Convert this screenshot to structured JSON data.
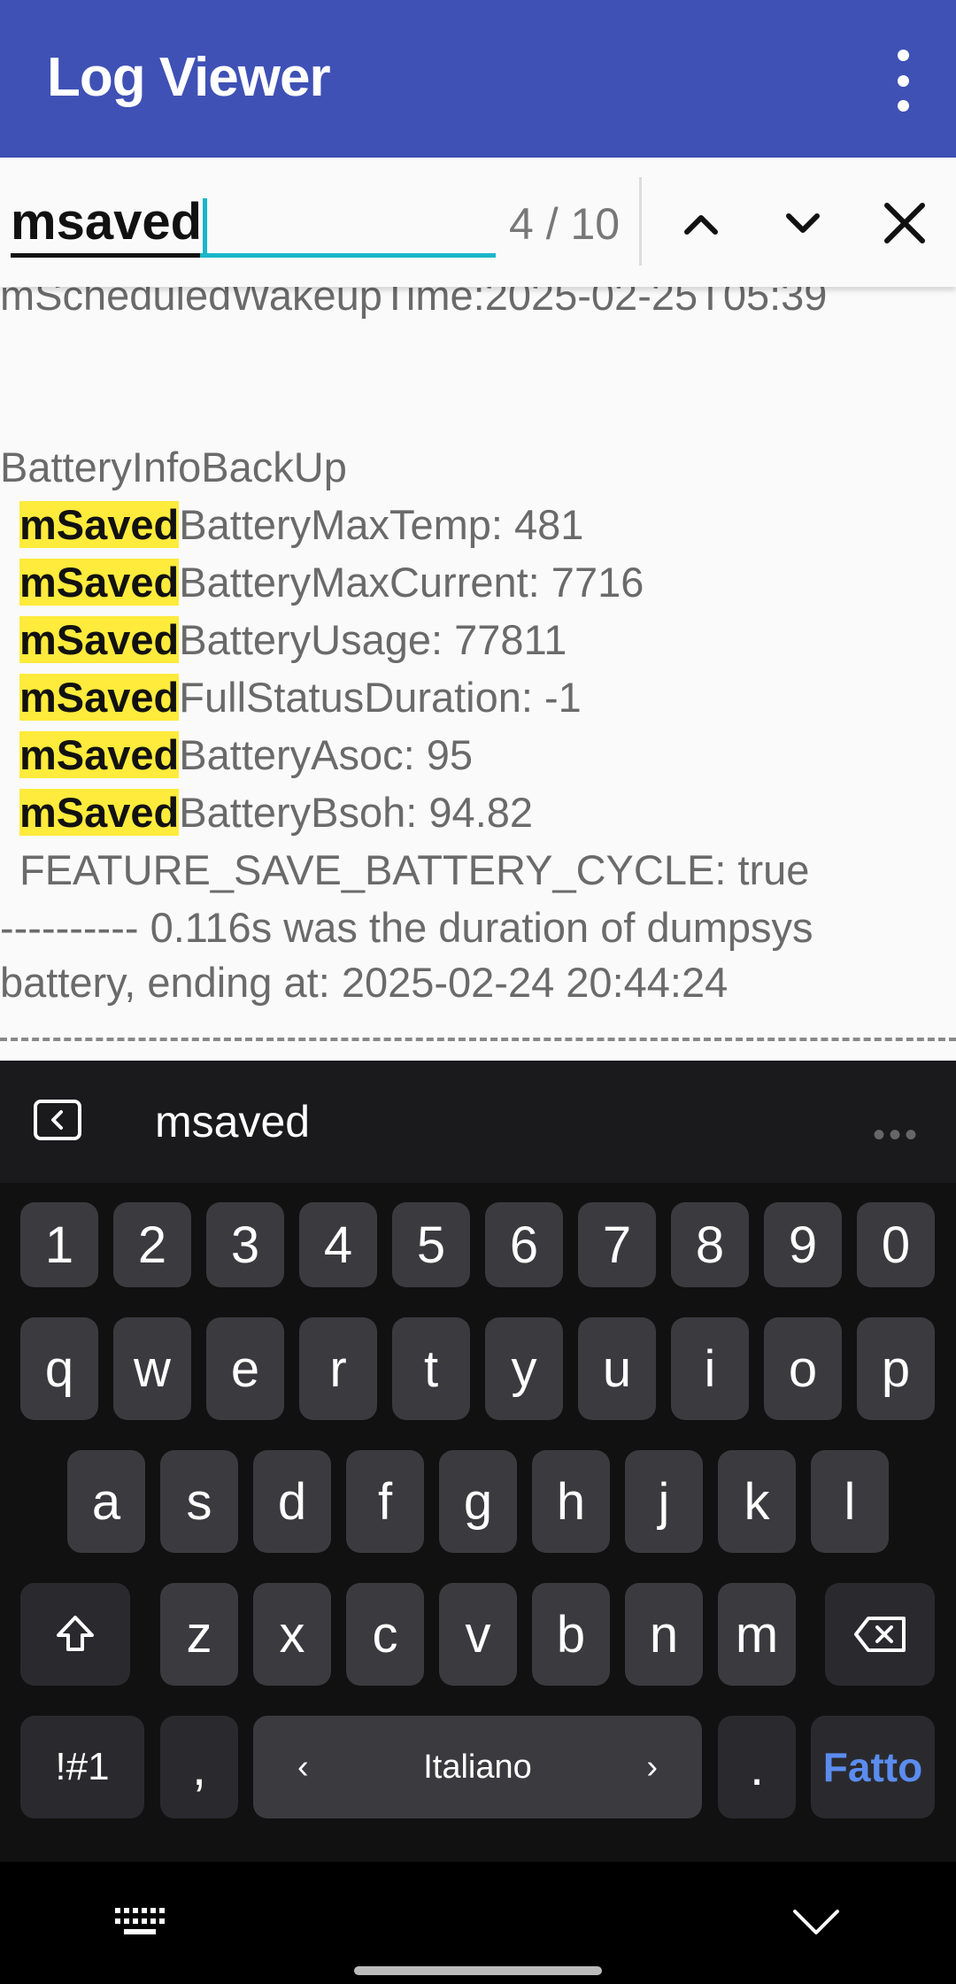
{
  "appbar": {
    "title": "Log Viewer",
    "overflow_icon": "more-vert-icon"
  },
  "find": {
    "query": "msaved",
    "count": "4 / 10",
    "prev_icon": "chevron-up-icon",
    "next_icon": "chevron-down-icon",
    "close_icon": "close-icon"
  },
  "log": {
    "lines": [
      "mScheduledWakeupTime:2025-02-25T05:39",
      "BatteryInfoBackUp",
      "BatteryMaxTemp: 481",
      "BatteryMaxCurrent: 7716",
      "BatteryUsage: 77811",
      "FullStatusDuration: -1",
      "BatteryAsoc: 95",
      "BatteryBsoh: 94.82",
      "FEATURE_SAVE_BATTERY_CYCLE: true",
      "---------- 0.116s was the duration of dumpsys",
      "battery, ending at: 2025-02-24 20:44:24"
    ],
    "highlight": "mSaved"
  },
  "keyboard": {
    "suggestion": "msaved",
    "row1": [
      "1",
      "2",
      "3",
      "4",
      "5",
      "6",
      "7",
      "8",
      "9",
      "0"
    ],
    "row2": [
      "q",
      "w",
      "e",
      "r",
      "t",
      "y",
      "u",
      "i",
      "o",
      "p"
    ],
    "row3": [
      "a",
      "s",
      "d",
      "f",
      "g",
      "h",
      "j",
      "k",
      "l"
    ],
    "row4": [
      "z",
      "x",
      "c",
      "v",
      "b",
      "n",
      "m"
    ],
    "symbols": "!#1",
    "comma": ",",
    "space_lang": "Italiano",
    "lang_prev": "‹",
    "lang_next": "›",
    "period": ".",
    "done": "Fatto"
  }
}
